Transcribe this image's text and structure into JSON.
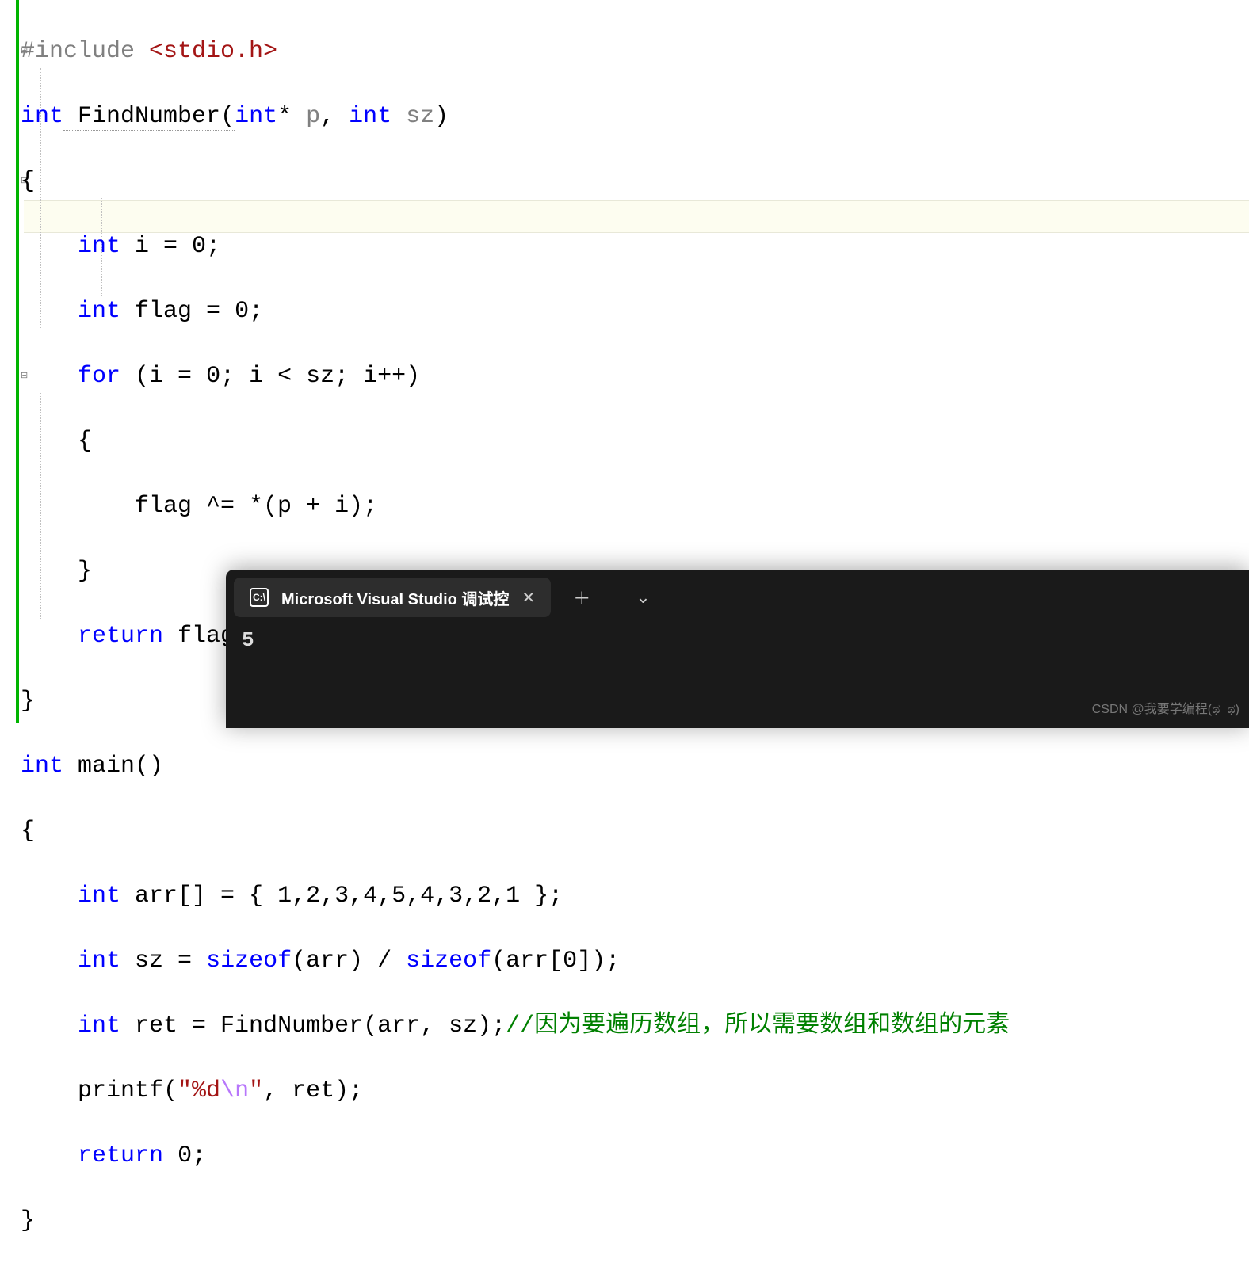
{
  "code": {
    "l1": {
      "pre": "#include ",
      "inc": "<stdio.h>"
    },
    "l2": {
      "kw1": "int",
      "fn": " FindNumber(",
      "kw2": "int",
      "ptr": "*",
      "p1": " p",
      "comma": ", ",
      "kw3": "int",
      "p2": " sz",
      "close": ")"
    },
    "l3": "{",
    "l4": {
      "kw": "int",
      "rest": " i = ",
      "num": "0",
      "semi": ";"
    },
    "l5": {
      "kw": "int",
      "rest": " flag = ",
      "num": "0",
      "semi": ";"
    },
    "l6": {
      "kw": "for",
      "rest": " (i = ",
      "n1": "0",
      "mid": "; i < sz; i++)"
    },
    "l7": "{",
    "l8": "flag ^= *(p + i);",
    "l9": "}",
    "l10": {
      "kw": "return",
      "rest": " flag;"
    },
    "l11": "}",
    "l12": {
      "kw1": "int",
      "fn": " main()"
    },
    "l13": "{",
    "l14": {
      "kw": "int",
      "rest": " arr[] = { ",
      "nums": "1,2,3,4,5,4,3,2,1",
      "end": " };"
    },
    "l15": {
      "kw": "int",
      "a": " sz = ",
      "sz1": "sizeof",
      "b": "(arr) / ",
      "sz2": "sizeof",
      "c": "(arr[",
      "n": "0",
      "d": "]);"
    },
    "l16": {
      "kw": "int",
      "a": " ret = FindNumber(arr, sz);",
      "cmt": "//因为要遍历数组，所以需要数组和数组的元素"
    },
    "l17": {
      "a": "printf(",
      "s1": "\"%d",
      "esc": "\\n",
      "s2": "\"",
      "b": ", ret);"
    },
    "l18": {
      "kw": "return",
      "sp": " ",
      "n": "0",
      "semi": ";"
    },
    "l19": "}"
  },
  "terminal": {
    "tab_title": "Microsoft Visual Studio 调试控",
    "tab_icon_text": "C:\\",
    "output": "5"
  },
  "watermark": "CSDN @我要学编程(ಥ_ಥ)"
}
